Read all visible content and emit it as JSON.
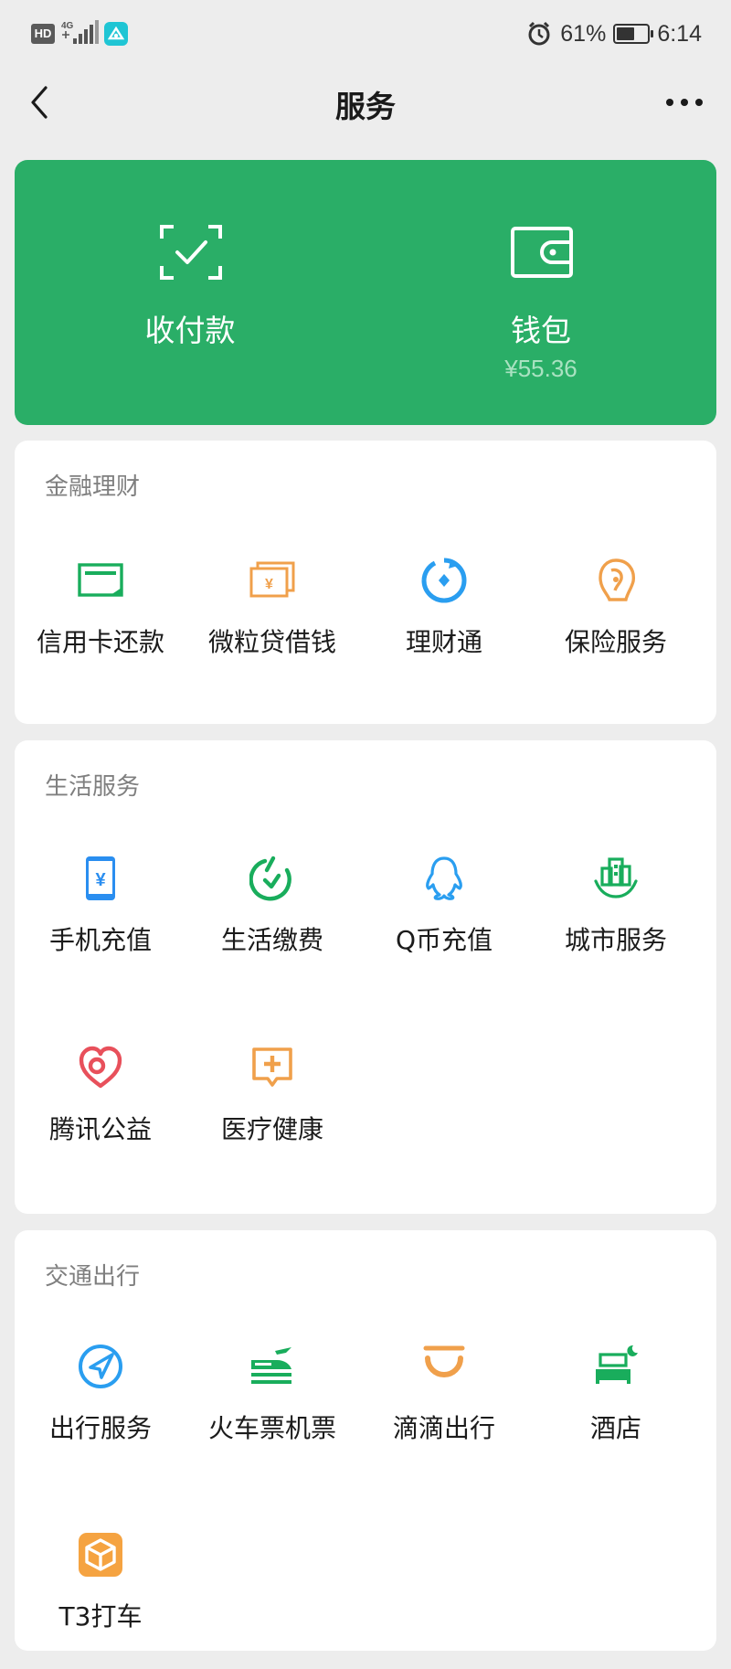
{
  "status_bar": {
    "hd_label": "HD",
    "network_label": "4G",
    "battery_percent_text": "61%",
    "battery_level": 0.61,
    "time": "6:14"
  },
  "nav": {
    "title": "服务",
    "back_icon": "chevron-left-icon",
    "more_icon": "more-dots-icon"
  },
  "pay_card": {
    "color": "#2aae67",
    "receive_pay": {
      "label": "收付款",
      "icon": "scan-check-icon"
    },
    "wallet": {
      "label": "钱包",
      "balance": "¥55.36",
      "icon": "wallet-icon"
    }
  },
  "sections": [
    {
      "title": "金融理财",
      "items": [
        {
          "label": "信用卡还款",
          "icon": "credit-card-icon",
          "color": "#19ad5c"
        },
        {
          "label": "微粒贷借钱",
          "icon": "loan-bill-icon",
          "color": "#f0a04b"
        },
        {
          "label": "理财通",
          "icon": "wealth-icon",
          "color": "#2a9ef0"
        },
        {
          "label": "保险服务",
          "icon": "insurance-icon",
          "color": "#f0a04b"
        }
      ]
    },
    {
      "title": "生活服务",
      "items": [
        {
          "label": "手机充值",
          "icon": "phone-topup-icon",
          "color": "#2a8ef0"
        },
        {
          "label": "生活缴费",
          "icon": "utility-payment-icon",
          "color": "#19ad5c"
        },
        {
          "label": "Q币充值",
          "icon": "qq-penguin-icon",
          "color": "#2a9ef0"
        },
        {
          "label": "城市服务",
          "icon": "city-buildings-icon",
          "color": "#19ad5c"
        },
        {
          "label": "腾讯公益",
          "icon": "charity-heart-icon",
          "color": "#e8505b"
        },
        {
          "label": "医疗健康",
          "icon": "medical-chat-icon",
          "color": "#f0a04b"
        }
      ]
    },
    {
      "title": "交通出行",
      "items": [
        {
          "label": "出行服务",
          "icon": "navigation-arrow-icon",
          "color": "#2a9ef0"
        },
        {
          "label": "火车票机票",
          "icon": "train-plane-icon",
          "color": "#19ad5c"
        },
        {
          "label": "滴滴出行",
          "icon": "didi-icon",
          "color": "#f0a04b"
        },
        {
          "label": "酒店",
          "icon": "hotel-bed-icon",
          "color": "#19ad5c"
        },
        {
          "label": "T3打车",
          "icon": "t3-box-icon",
          "color": "#f0a04b"
        }
      ]
    }
  ]
}
